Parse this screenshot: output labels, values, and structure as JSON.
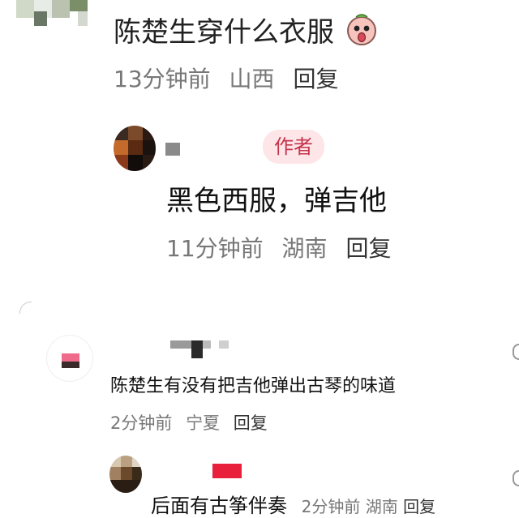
{
  "comment1": {
    "text": "陈楚生穿什么衣服",
    "emoji": "surprised-face-emoji",
    "time": "13分钟前",
    "location": "山西",
    "reply": "回复"
  },
  "reply1": {
    "badge": "作者",
    "text": "黑色西服，弹吉他",
    "time": "11分钟前",
    "location": "湖南",
    "reply": "回复"
  },
  "comment2": {
    "text": "陈楚生有没有把吉他弹出古琴的味道",
    "time": "2分钟前",
    "location": "宁夏",
    "reply": "回复"
  },
  "reply2": {
    "text": "后面有古筝伴奏",
    "time": "2分钟前",
    "location": "湖南",
    "reply": "回复"
  },
  "colors": {
    "author_badge_bg": "#fde5e8",
    "author_badge_text": "#c6344c",
    "meta_text": "#777777"
  }
}
